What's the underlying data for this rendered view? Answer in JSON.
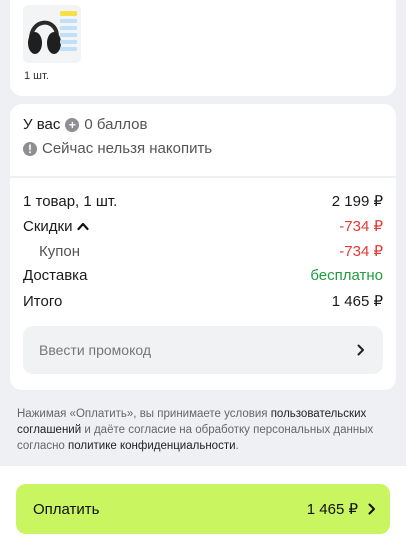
{
  "order": {
    "item_qty": "1 шт."
  },
  "points": {
    "label": "У вас",
    "value": "0 баллов",
    "info_text": "Сейчас нельзя накопить"
  },
  "summary": {
    "items_label": "1 товар, 1 шт.",
    "items_value": "2 199 ₽",
    "discounts_label": "Скидки",
    "discounts_value": "-734 ₽",
    "coupon_label": "Купон",
    "coupon_value": "-734 ₽",
    "delivery_label": "Доставка",
    "delivery_value": "бесплатно",
    "total_label": "Итого",
    "total_value": "1 465 ₽"
  },
  "promo": {
    "placeholder": "Ввести промокод"
  },
  "terms": {
    "prefix": "Нажимая «Оплатить», вы принимаете условия ",
    "link1": "пользовательских соглашений",
    "middle": " и даёте согласие на обработку персональных данных согласно ",
    "link2": "политике конфиденциальности",
    "suffix": "."
  },
  "pay_button": {
    "label": "Оплатить",
    "amount": "1 465 ₽"
  },
  "colors": {
    "pay_button": "#c8f560",
    "discount": "#e53935",
    "free_delivery": "#1e9e3e"
  },
  "icons": {
    "points": "plus-circle-icon",
    "info": "info-circle-icon",
    "discounts_toggle": "chevron-up-icon",
    "promo": "chevron-right-icon",
    "pay": "chevron-right-icon"
  }
}
